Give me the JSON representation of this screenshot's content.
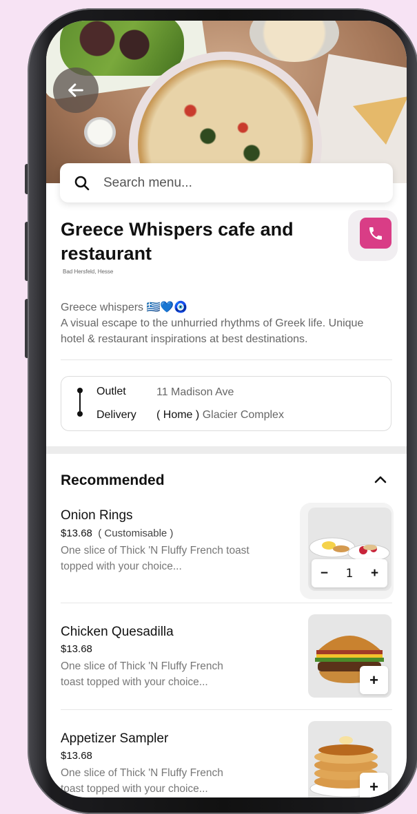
{
  "search": {
    "placeholder": "Search menu..."
  },
  "restaurant": {
    "name": "Greece Whispers cafe and restaurant",
    "location": "Bad Hersfeld, Hesse",
    "tagline": "Greece whispers 🇬🇷💙🧿",
    "description": "A visual escape to the unhurried rhythms of Greek life. Unique hotel & restaurant inspirations at best destinations."
  },
  "address": {
    "outlet_label": "Outlet",
    "outlet_value": "11 Madison Ave",
    "delivery_label": "Delivery",
    "delivery_tag": "( Home )",
    "delivery_value": "Glacier Complex"
  },
  "recommended": {
    "title": "Recommended",
    "items": [
      {
        "name": "Onion Rings",
        "price": "$13.68",
        "customisable": "( Customisable )",
        "description": "One slice of Thick 'N Fluffy French toast topped with your choice...",
        "quantity": "1"
      },
      {
        "name": "Chicken Quesadilla",
        "price": "$13.68",
        "description": "One slice of Thick 'N Fluffy French toast topped with your choice..."
      },
      {
        "name": "Appetizer Sampler",
        "price": "$13.68",
        "description": "One slice of Thick 'N Fluffy French toast topped with your choice..."
      }
    ]
  },
  "buttons": {
    "minus": "−",
    "plus": "+"
  },
  "colors": {
    "accent": "#d93d86",
    "background": "#f7e3f4"
  },
  "icons": [
    "back-arrow-icon",
    "search-icon",
    "phone-icon",
    "chevron-up-icon"
  ]
}
